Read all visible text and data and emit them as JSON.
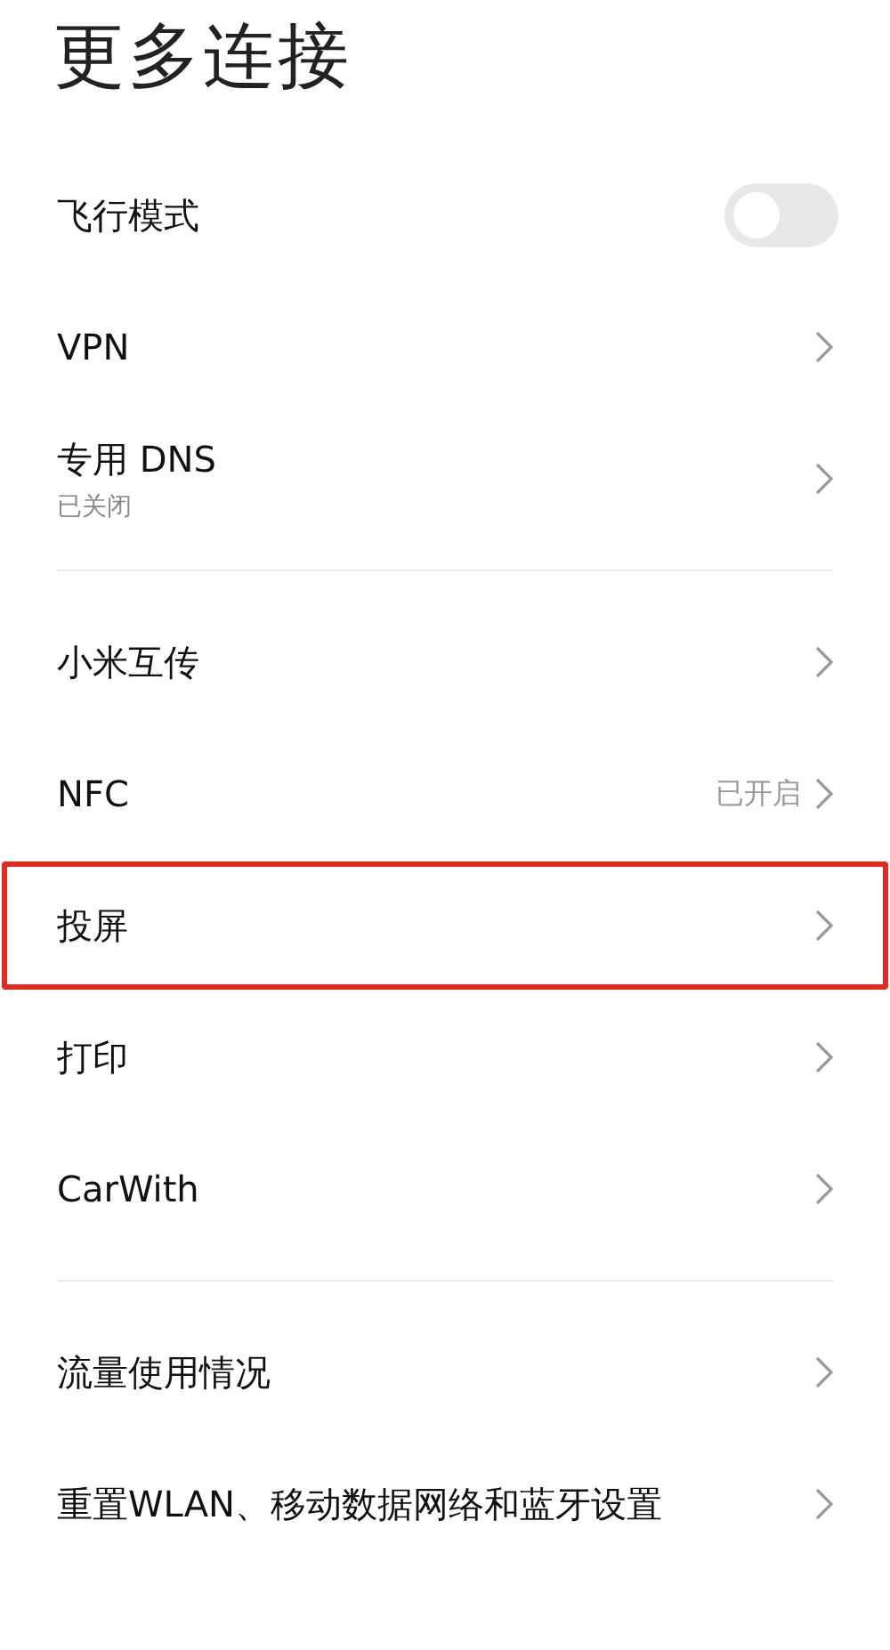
{
  "title": "更多连接",
  "sections": [
    {
      "rows": [
        {
          "kind": "toggle",
          "label": "飞行模式",
          "on": false
        },
        {
          "kind": "link",
          "label": "VPN"
        },
        {
          "kind": "link",
          "label": "专用 DNS",
          "summary": "已关闭"
        }
      ]
    },
    {
      "rows": [
        {
          "kind": "link",
          "label": "小米互传"
        },
        {
          "kind": "link",
          "label": "NFC",
          "value": "已开启"
        },
        {
          "kind": "link",
          "label": "投屏",
          "highlighted": true
        },
        {
          "kind": "link",
          "label": "打印"
        },
        {
          "kind": "link",
          "label": "CarWith"
        }
      ]
    },
    {
      "rows": [
        {
          "kind": "link",
          "label": "流量使用情况"
        },
        {
          "kind": "link",
          "label": "重置WLAN、移动数据网络和蓝牙设置"
        }
      ]
    }
  ]
}
